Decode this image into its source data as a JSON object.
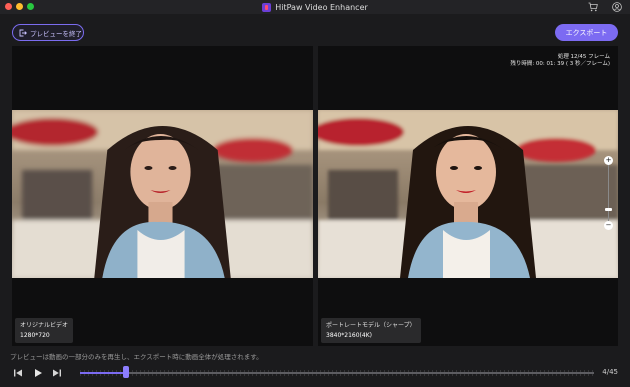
{
  "window": {
    "title": "HitPaw Video Enhancer",
    "icons": [
      "cart-icon",
      "user-icon"
    ]
  },
  "toolbar": {
    "exit_label": "プレビューを終了",
    "exit_icon": "exit-icon",
    "export_label": "エクスポート"
  },
  "left_panel": {
    "label": "オリジナルビデオ",
    "resolution": "1280*720"
  },
  "right_panel": {
    "label": "ポートレートモデル（シャープ）",
    "resolution": "3840*2160(4K)",
    "progress_line": "処理 12/45 フレーム",
    "remaining_line": "残り時間: 00: 01: 39 ( 3 秒／フレーム)"
  },
  "zoom": {
    "plus": "+",
    "minus": "−",
    "level": 0.2
  },
  "notice": "プレビューは動画の一部分のみを再生し、エクスポート時に動画全体が処理されます。",
  "player": {
    "frame_counter": "4/45",
    "current_frame": 4,
    "total_frames": 45,
    "controls": [
      "previous-frame-icon",
      "play-icon",
      "next-frame-icon"
    ]
  },
  "colors": {
    "accent": "#7c6bf2",
    "background": "#1b1b1d",
    "panel": "#0e0e0f"
  }
}
